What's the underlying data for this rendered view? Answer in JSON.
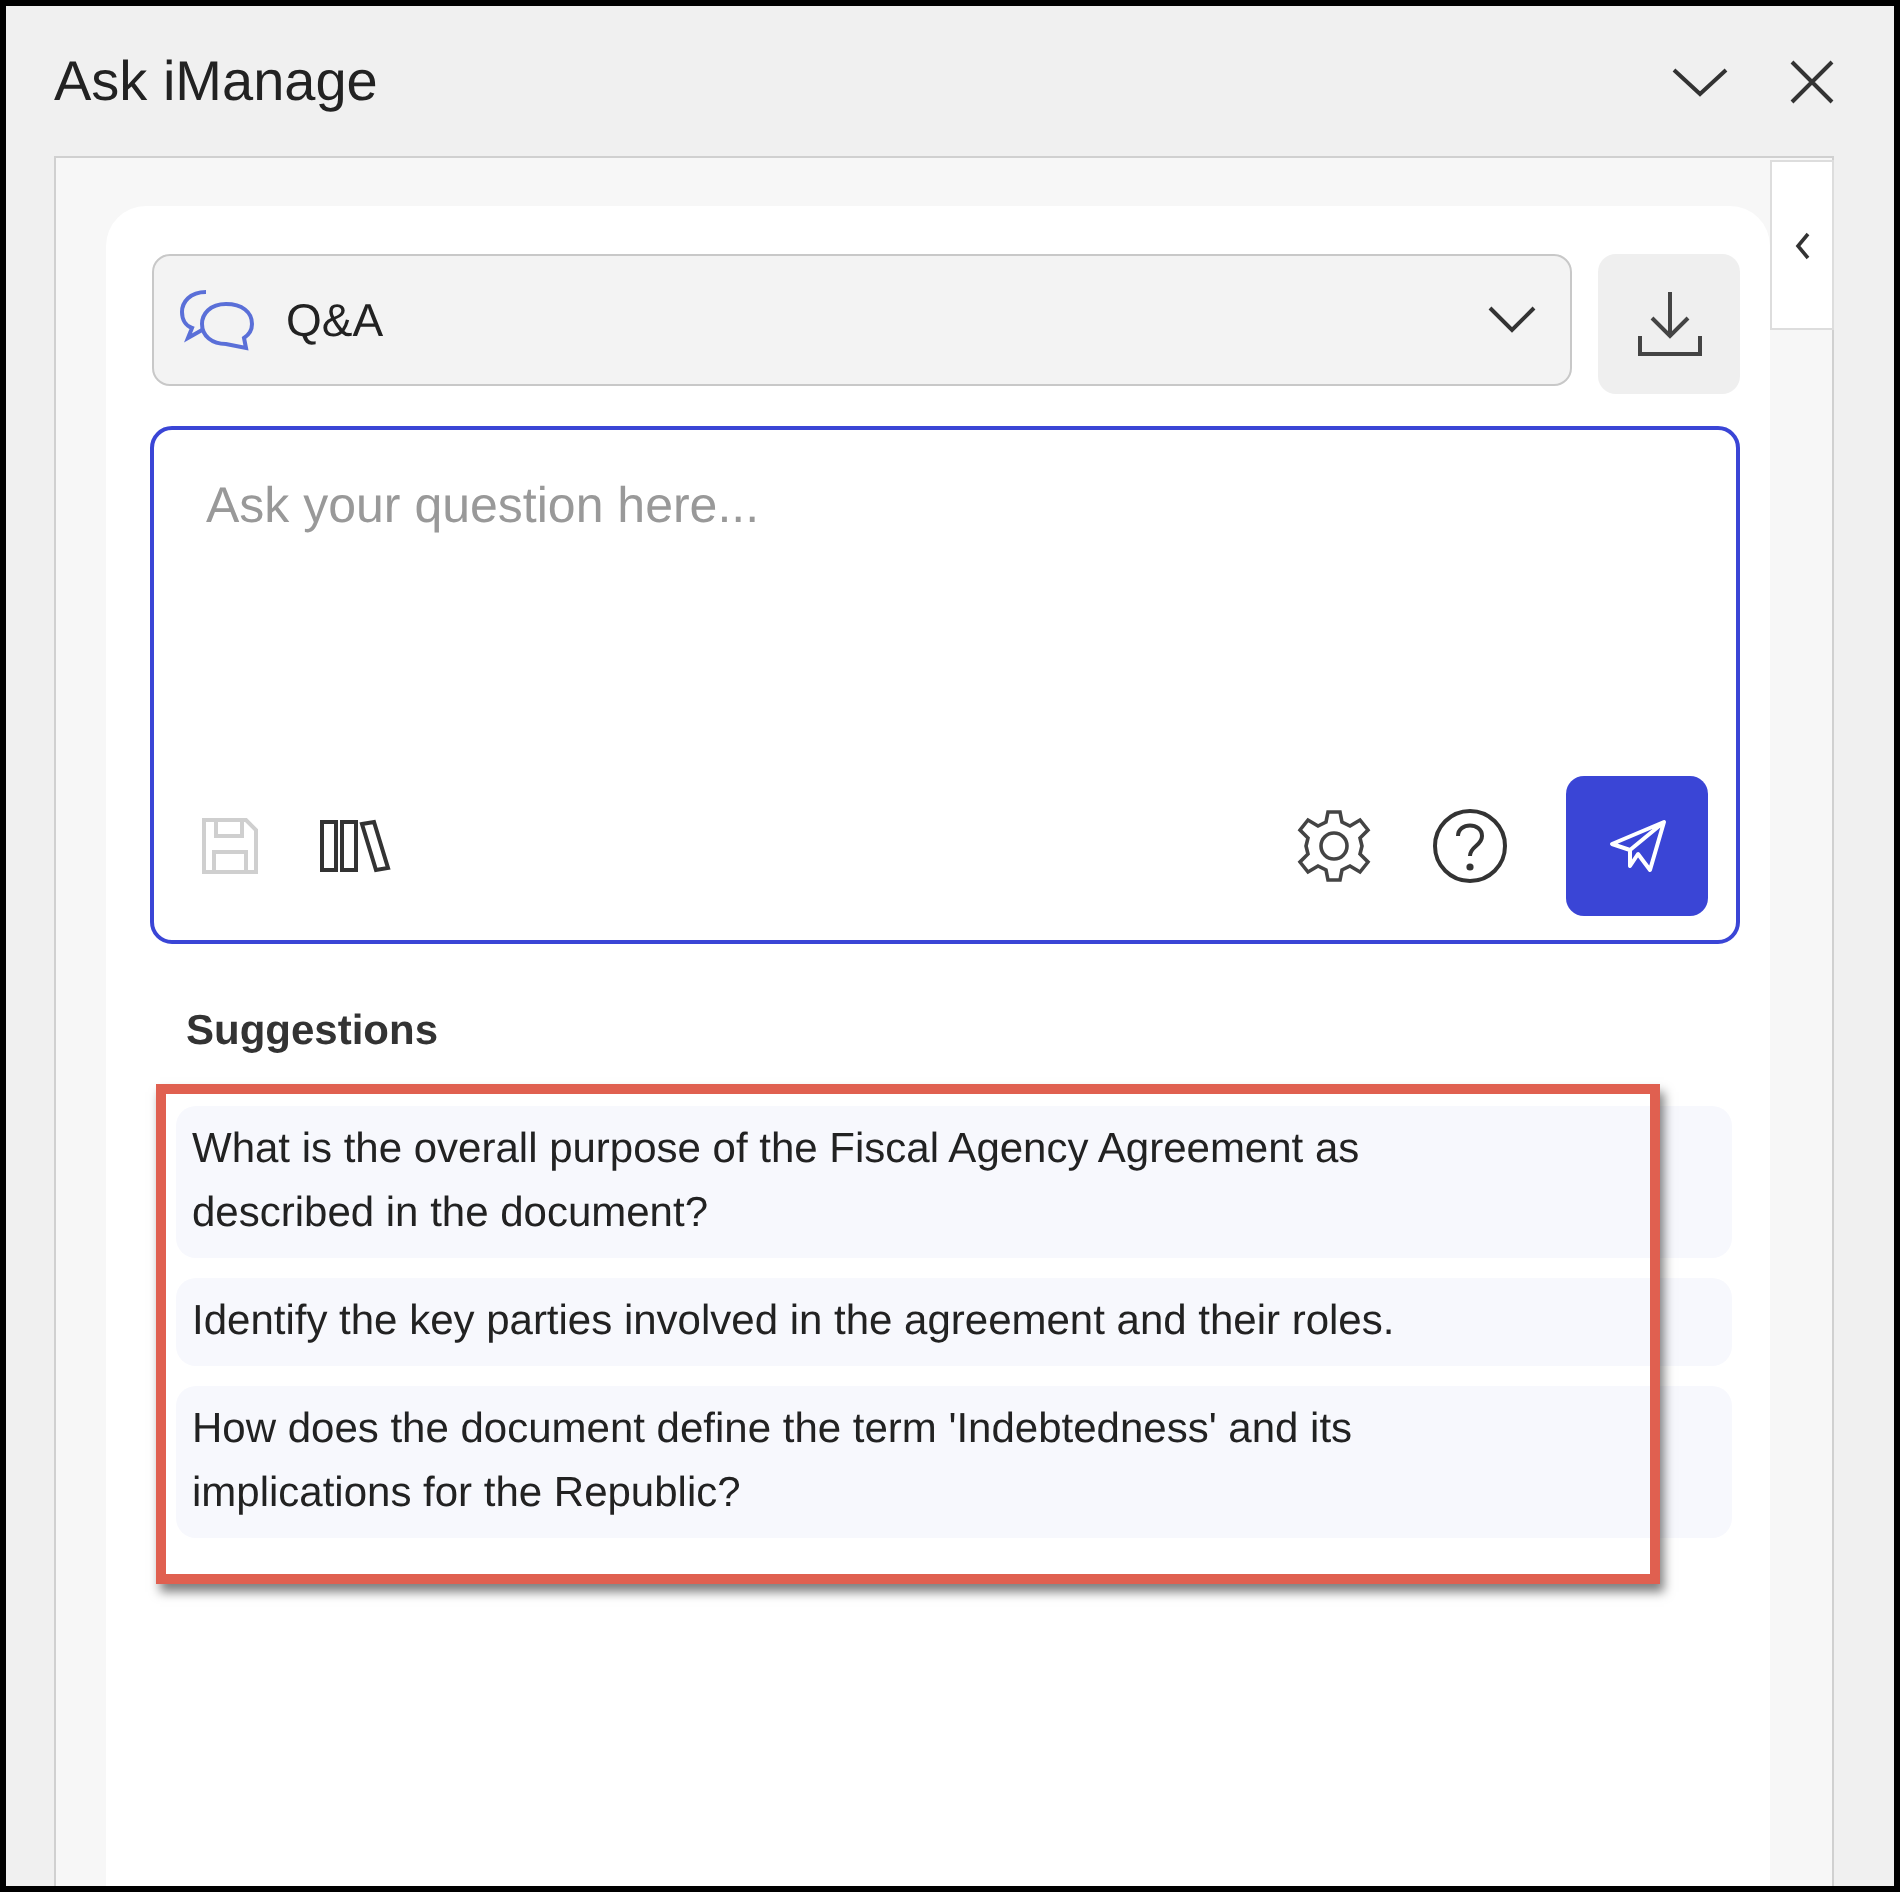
{
  "window": {
    "title": "Ask iManage"
  },
  "mode_dropdown": {
    "value": "Q&A"
  },
  "question_field": {
    "placeholder": "Ask your question here...",
    "save_disabled": true
  },
  "suggestions": {
    "heading": "Suggestions",
    "highlighted": true,
    "items": [
      {
        "text": "What is the overall purpose of the Fiscal Agency Agreement as described in the document?"
      },
      {
        "text": "Identify the key parties involved in the agreement and their roles."
      },
      {
        "text": "How does the document define the term 'Indebtedness' and its implications for the Republic?"
      }
    ]
  }
}
